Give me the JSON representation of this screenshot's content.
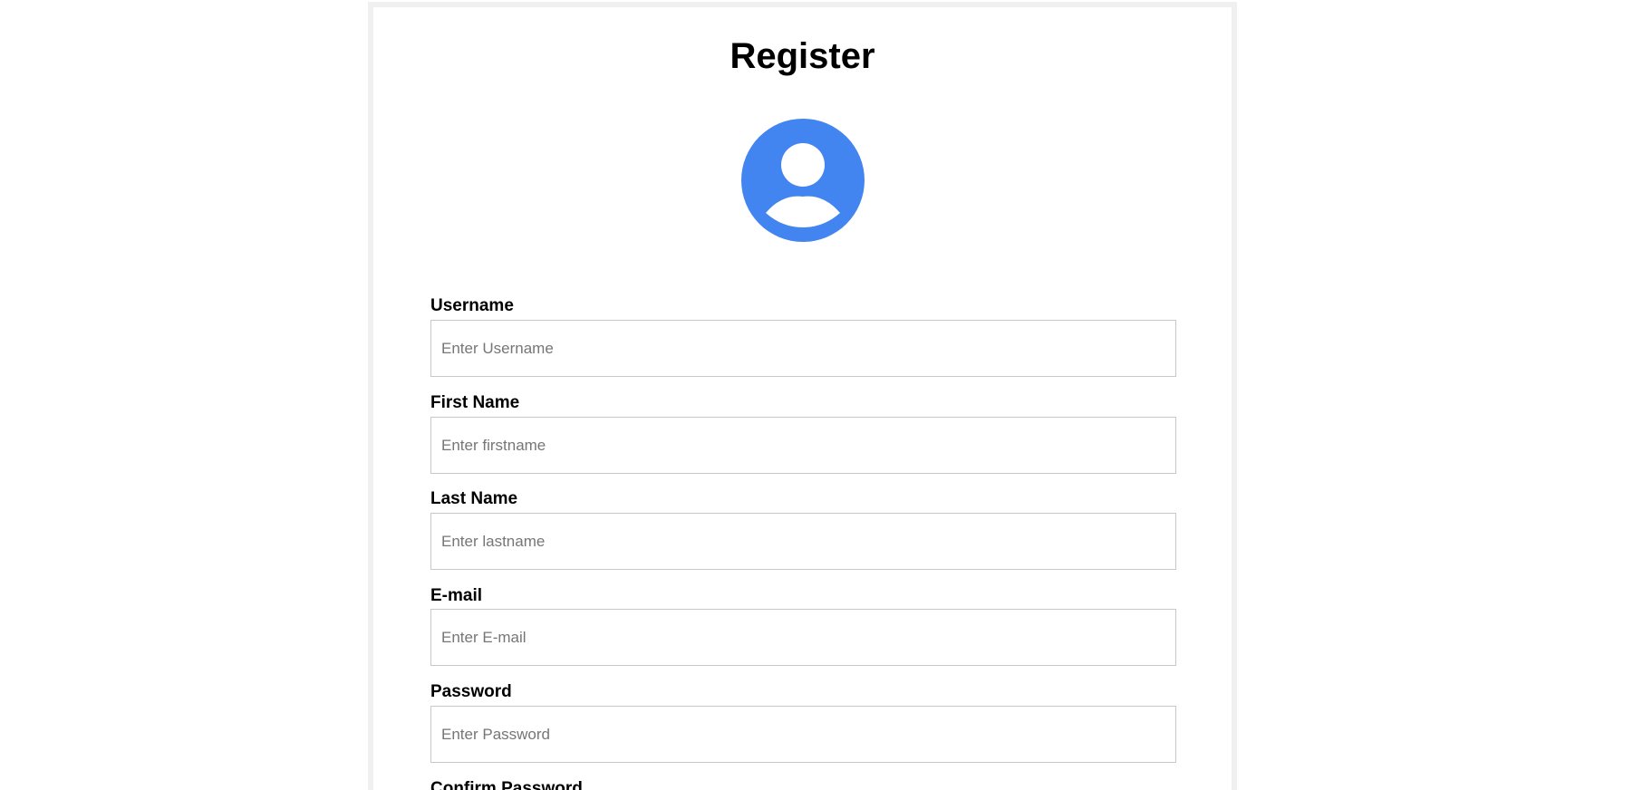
{
  "form": {
    "title": "Register",
    "avatar_icon": "user-avatar-icon",
    "accent_color": "#4285f0",
    "fields": {
      "username": {
        "label": "Username",
        "placeholder": "Enter Username"
      },
      "firstname": {
        "label": "First Name",
        "placeholder": "Enter firstname"
      },
      "lastname": {
        "label": "Last Name",
        "placeholder": "Enter lastname"
      },
      "email": {
        "label": "E-mail",
        "placeholder": "Enter E-mail"
      },
      "password": {
        "label": "Password",
        "placeholder": "Enter Password"
      },
      "confirm_password": {
        "label": "Confirm Password"
      }
    }
  }
}
